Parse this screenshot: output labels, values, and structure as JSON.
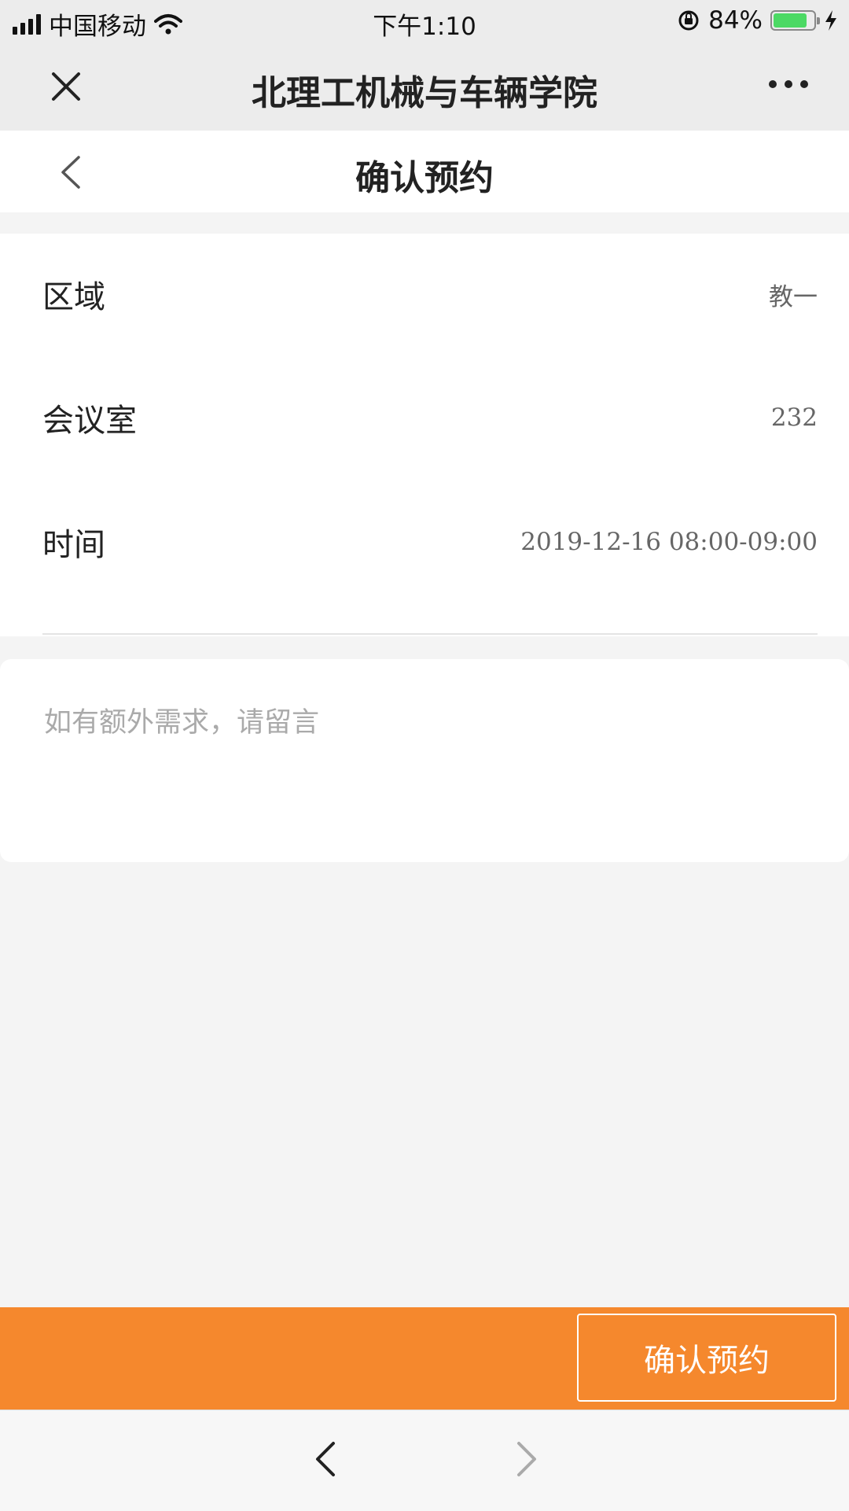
{
  "status_bar": {
    "carrier": "中国移动",
    "time": "下午1:10",
    "battery_percent": "84%",
    "battery_level": 0.84,
    "battery_color": "#4cd964"
  },
  "nav": {
    "title": "北理工机械与车辆学院",
    "close_icon": "close-icon",
    "more_icon": "more-icon"
  },
  "page": {
    "title": "确认预约",
    "back_icon": "chevron-left-icon"
  },
  "booking": {
    "rows": [
      {
        "label": "区域",
        "value": "教一"
      },
      {
        "label": "会议室",
        "value": "232"
      },
      {
        "label": "时间",
        "value": "2019-12-16 08:00-09:00"
      }
    ]
  },
  "note": {
    "placeholder": "如有额外需求，请留言",
    "value": ""
  },
  "action": {
    "confirm_label": "确认预约",
    "accent_color": "#f5882d"
  },
  "browser": {
    "back_icon": "chevron-left-icon",
    "forward_icon": "chevron-right-icon"
  }
}
